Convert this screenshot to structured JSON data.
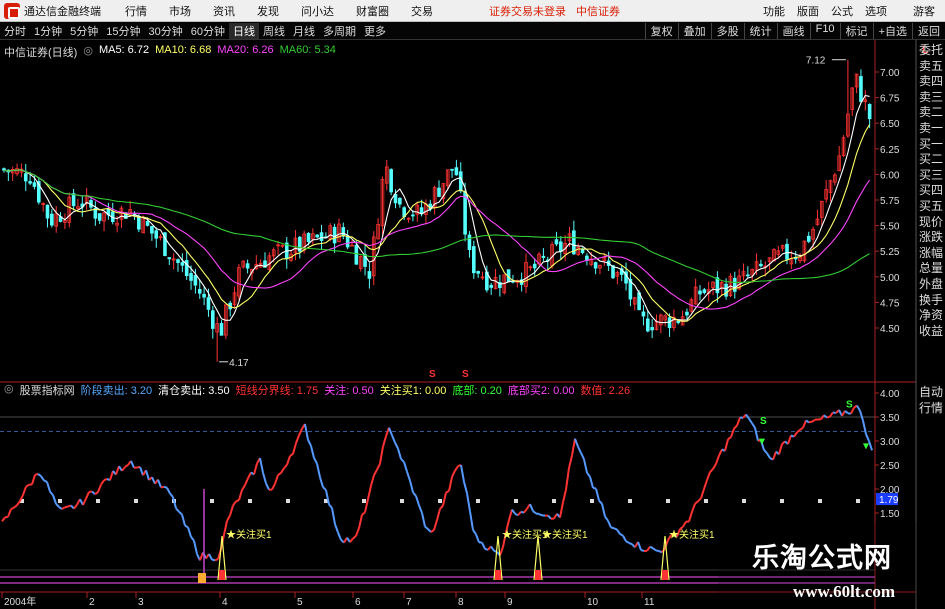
{
  "app": {
    "title": "通达信金融终端",
    "menu": [
      "行情",
      "市场",
      "资讯",
      "发现",
      "问小达",
      "财富圈",
      "交易"
    ],
    "login_warning": "证券交易未登录",
    "broker": "中信证券",
    "right_menu": [
      "功能",
      "版面",
      "公式",
      "选项"
    ],
    "guest": "游客"
  },
  "periods": [
    "分时",
    "1分钟",
    "5分钟",
    "15分钟",
    "30分钟",
    "60分钟",
    "日线",
    "周线",
    "月线",
    "多周期",
    "更多"
  ],
  "active_period": "日线",
  "toolbar_right": [
    "复权",
    "叠加",
    "多股",
    "统计",
    "画线",
    "F10",
    "标记",
    "+自选",
    "返回"
  ],
  "main_panel": {
    "stock_name": "中信证券(日线)",
    "ma5": "MA5: 6.72",
    "ma10": "MA10: 6.68",
    "ma20": "MA20: 6.26",
    "ma60": "MA60: 5.34",
    "price_ticks": [
      "7.00",
      "6.75",
      "6.50",
      "6.25",
      "6.00",
      "5.75",
      "5.50",
      "5.25",
      "5.00",
      "4.75",
      "4.50"
    ],
    "high_label": "7.12",
    "low_label": "4.17",
    "corner_mark": "L",
    "s_markers": [
      "S",
      "S"
    ]
  },
  "indicator_panel": {
    "name": "股票指标网",
    "items": [
      {
        "label": "阶段卖出:",
        "value": "3.20",
        "color": "#55aaff"
      },
      {
        "label": "清仓卖出:",
        "value": "3.50",
        "color": "#ffffff"
      },
      {
        "label": "短线分界线:",
        "value": "1.75",
        "color": "#ff3333"
      },
      {
        "label": "关注:",
        "value": "0.50",
        "color": "#ff44ff"
      },
      {
        "label": "关注买1:",
        "value": "0.00",
        "color": "#ffff66"
      },
      {
        "label": "底部:",
        "value": "0.20",
        "color": "#33ff33"
      },
      {
        "label": "底部买2:",
        "value": "0.00",
        "color": "#ff44ff"
      },
      {
        "label": "数值:",
        "value": "2.26",
        "color": "#ff3333"
      }
    ],
    "ticks": [
      "4.00",
      "3.50",
      "3.00",
      "2.50",
      "2.00",
      "1.50"
    ],
    "current_value": "1.79",
    "buy_labels": [
      "关注买1",
      "关注买1",
      "关注买1",
      "关注买1"
    ]
  },
  "date_axis": [
    "2004年",
    "2",
    "3",
    "4",
    "5",
    "6",
    "7",
    "8",
    "9",
    "10",
    "11"
  ],
  "right_tabs": [
    "委托",
    "卖五",
    "卖四",
    "卖三",
    "卖二",
    "卖一",
    "买一",
    "买二",
    "买三",
    "买四",
    "买五",
    "现价",
    "涨跌",
    "涨幅",
    "总量",
    "外盘",
    "换手",
    "净资",
    "收益"
  ],
  "right_tabs_lower": [
    "自动",
    "行情"
  ],
  "watermark": {
    "title": "乐淘公式网",
    "url": "www.60lt.com"
  },
  "colors": {
    "up": "#ff3333",
    "down": "#54ffff",
    "ma5": "#ffffff",
    "ma10": "#ffff66",
    "ma20": "#ff44ff",
    "ma60": "#33cc33",
    "osc_down": "#5599ff"
  }
}
